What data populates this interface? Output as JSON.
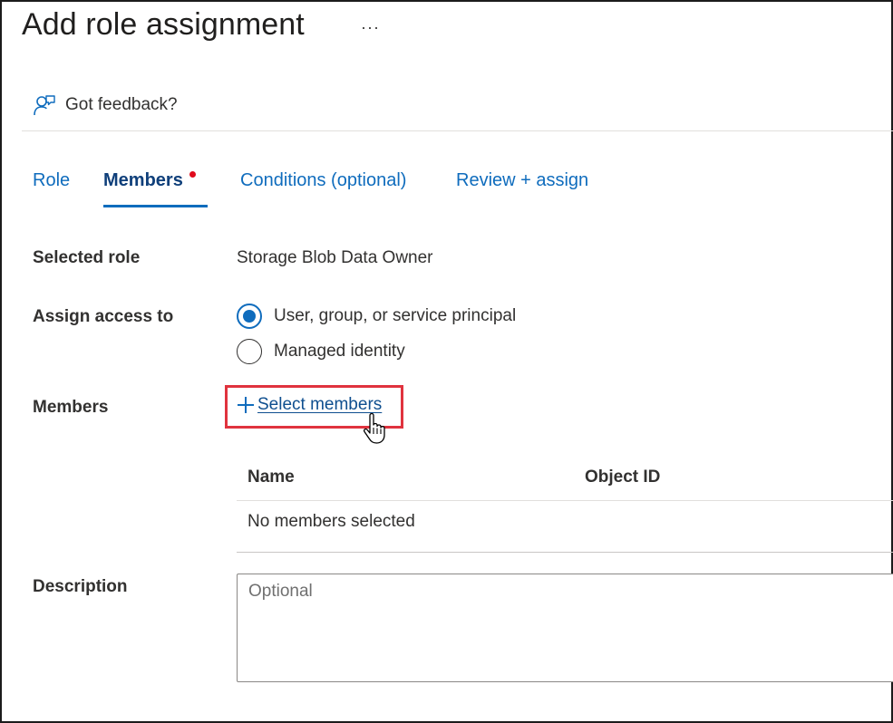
{
  "header": {
    "title": "Add role assignment",
    "more_label": "···"
  },
  "feedback": {
    "label": "Got feedback?",
    "icon": "feedback-person-icon"
  },
  "tabs": [
    {
      "label": "Role",
      "active": false
    },
    {
      "label": "Members",
      "active": true,
      "has_error_dot": true
    },
    {
      "label": "Conditions (optional)",
      "active": false
    },
    {
      "label": "Review + assign",
      "active": false
    }
  ],
  "form": {
    "selected_role": {
      "label": "Selected role",
      "value": "Storage Blob Data Owner"
    },
    "assign_access": {
      "label": "Assign access to",
      "options": [
        {
          "label": "User, group, or service principal",
          "selected": true
        },
        {
          "label": "Managed identity",
          "selected": false
        }
      ]
    },
    "members": {
      "label": "Members",
      "select_label": "Select members",
      "columns": [
        "Name",
        "Object ID"
      ],
      "empty_text": "No members selected"
    },
    "description": {
      "label": "Description",
      "placeholder": "Optional",
      "value": ""
    }
  },
  "colors": {
    "accent": "#0f6cbd",
    "highlight_box": "#e0333e",
    "error_dot": "#e00b1c"
  }
}
